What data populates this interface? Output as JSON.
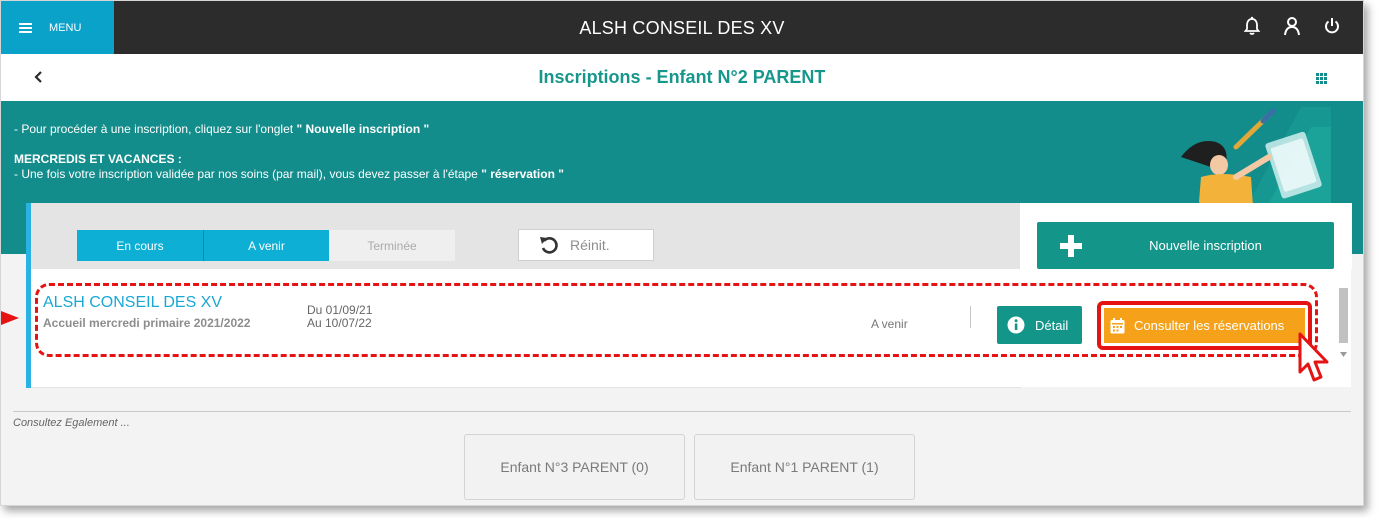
{
  "topbar": {
    "menu_label": "MENU",
    "app_title": "ALSH CONSEIL DES XV",
    "icons": [
      "bell-icon",
      "user-icon",
      "power-icon"
    ]
  },
  "header": {
    "title": "Inscriptions  -  Enfant N°2 PARENT"
  },
  "banner": {
    "line1_prefix": "- Pour procéder à une inscription, cliquez sur l'onglet ",
    "line1_bold": "\" Nouvelle inscription \"",
    "heading": "MERCREDIS ET VACANCES :",
    "line2_prefix": "- Une fois votre inscription validée par nos soins (par mail), vous devez passer à l'étape ",
    "line2_bold": "\" réservation \""
  },
  "filters": {
    "tabs": [
      {
        "label": "En cours",
        "active": true
      },
      {
        "label": "A venir",
        "active": true
      },
      {
        "label": "Terminée",
        "active": false
      }
    ],
    "reset_label": "Réinit."
  },
  "actions": {
    "new_inscription_label": "Nouvelle inscription"
  },
  "inscriptions": [
    {
      "name": "ALSH CONSEIL DES XV",
      "activity": "Accueil mercredi primaire 2021/2022",
      "date_from": "Du 01/09/21",
      "date_to": "Au 10/07/22",
      "status": "A venir",
      "detail_label": "Détail",
      "consult_label": "Consulter les réservations"
    }
  ],
  "also": {
    "label": "Consultez Egalement ...",
    "children": [
      "Enfant N°3 PARENT (0)",
      "Enfant N°1 PARENT (1)"
    ]
  },
  "colors": {
    "accent_blue": "#0dafd5",
    "teal": "#14958a",
    "banner": "#138d8b",
    "orange": "#f5a21a",
    "highlight_red": "#e51313"
  }
}
